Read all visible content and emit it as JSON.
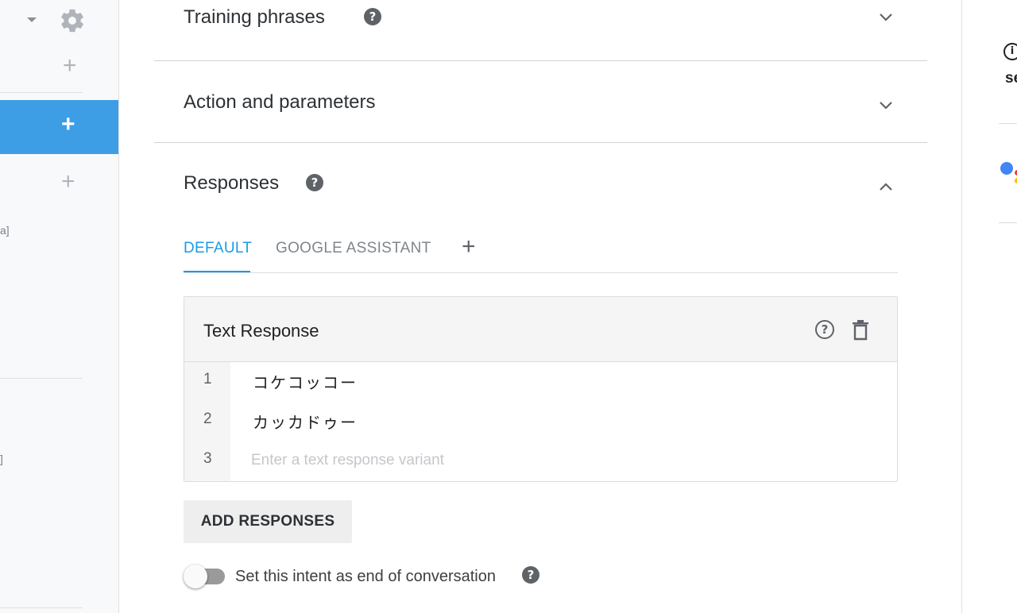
{
  "sidebar": {
    "snippets": [
      "a]",
      "]"
    ]
  },
  "sections": {
    "training": {
      "title": "Training phrases",
      "help_icon": "?"
    },
    "action": {
      "title": "Action and parameters"
    },
    "responses": {
      "title": "Responses",
      "help_icon": "?"
    }
  },
  "tabs": {
    "items": [
      {
        "label": "DEFAULT",
        "active": true
      },
      {
        "label": "GOOGLE ASSISTANT",
        "active": false
      }
    ],
    "add_label": "+"
  },
  "text_response": {
    "title": "Text Response",
    "help_icon": "?",
    "rows": [
      {
        "num": "1",
        "text": "コケコッコー"
      },
      {
        "num": "2",
        "text": "カッカドゥー"
      }
    ],
    "new_row": {
      "num": "3",
      "value": "",
      "placeholder": "Enter a text response variant"
    }
  },
  "add_responses_label": "ADD RESPONSES",
  "end_conversation": {
    "label": "Set this intent as end of conversation",
    "enabled": false,
    "help_icon": "?"
  },
  "right_panel": {
    "info_icon": "i",
    "text": "se"
  },
  "colors": {
    "accent": "#1a9be6",
    "sidebar_active": "#3d9ee5"
  }
}
